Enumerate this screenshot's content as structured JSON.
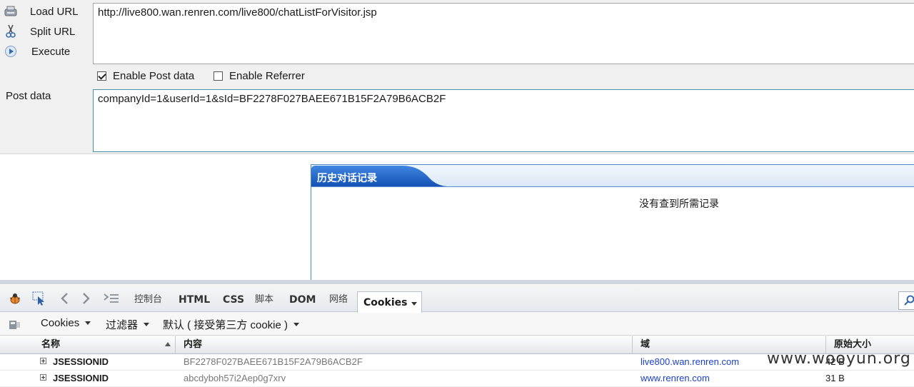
{
  "hackbar": {
    "buttons": [
      {
        "label": "Load URL",
        "icon": "load-url-icon"
      },
      {
        "label": "Split URL",
        "icon": "scissors-icon"
      },
      {
        "label": "Execute",
        "icon": "play-icon"
      }
    ],
    "url": "http://live800.wan.renren.com/live800/chatListForVisitor.jsp",
    "enable_post_label": "Enable Post data",
    "enable_post_checked": true,
    "enable_referrer_label": "Enable Referrer",
    "enable_referrer_checked": false,
    "post_label": "Post data",
    "post_data": "companyId=1&userId=1&sId=BF2278F027BAEE671B15F2A79B6ACB2F"
  },
  "page": {
    "panel_title": "历史对话记录",
    "empty_message": "没有查到所需记录"
  },
  "firebug": {
    "tabs": [
      "控制台",
      "HTML",
      "CSS",
      "脚本",
      "DOM",
      "网络"
    ],
    "active_tab": "Cookies",
    "sub": {
      "cookies_menu": "Cookies",
      "filter_menu": "过滤器",
      "default_menu": "默认 ( 接受第三方 cookie )"
    },
    "columns": [
      "名称",
      "内容",
      "域",
      "原始大小"
    ],
    "rows": [
      {
        "name": "JSESSIONID",
        "content": "BF2278F027BAEE671B15F2A79B6ACB2F",
        "domain": "live800.wan.renren.com",
        "size": "42 B"
      },
      {
        "name": "JSESSIONID",
        "content": "abcdyboh57i2Aep0g7xrv",
        "domain": "www.renren.com",
        "size": "31 B"
      }
    ]
  },
  "watermark": "www.wooyun.org"
}
